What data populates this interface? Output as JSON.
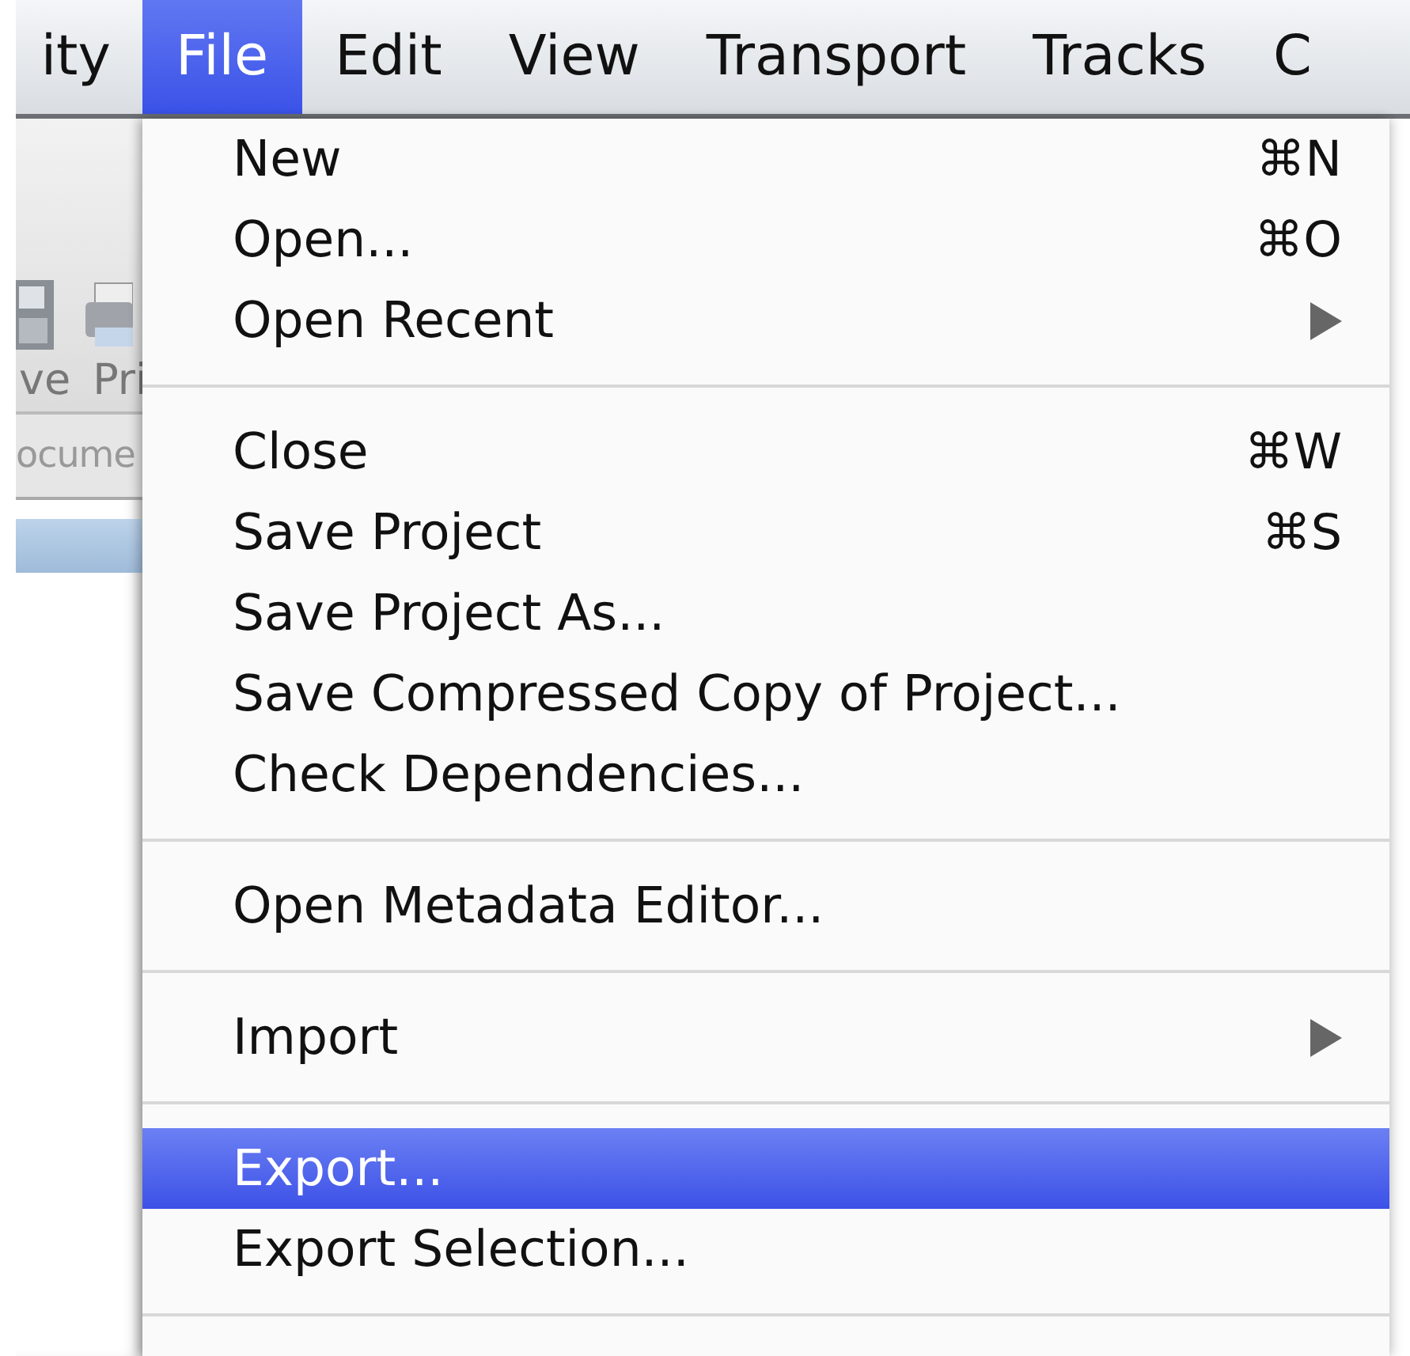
{
  "menubar": {
    "items": [
      {
        "label": "ity",
        "selected": false
      },
      {
        "label": "File",
        "selected": true
      },
      {
        "label": "Edit",
        "selected": false
      },
      {
        "label": "View",
        "selected": false
      },
      {
        "label": "Transport",
        "selected": false
      },
      {
        "label": "Tracks",
        "selected": false
      },
      {
        "label": "C",
        "selected": false
      }
    ]
  },
  "background_window": {
    "toolbar_labels": [
      "ve",
      "Pri"
    ],
    "tab_label": "ocume"
  },
  "menu": {
    "items": [
      {
        "kind": "item",
        "label": "New",
        "shortcut": "⌘N",
        "submenu": false,
        "selected": false
      },
      {
        "kind": "item",
        "label": "Open...",
        "shortcut": "⌘O",
        "submenu": false,
        "selected": false
      },
      {
        "kind": "item",
        "label": "Open Recent",
        "submenu": true,
        "selected": false
      },
      {
        "kind": "separator"
      },
      {
        "kind": "item",
        "label": "Close",
        "shortcut": "⌘W",
        "submenu": false,
        "selected": false
      },
      {
        "kind": "item",
        "label": "Save Project",
        "shortcut": "⌘S",
        "submenu": false,
        "selected": false
      },
      {
        "kind": "item",
        "label": "Save Project As...",
        "submenu": false,
        "selected": false
      },
      {
        "kind": "item",
        "label": "Save Compressed Copy of Project...",
        "submenu": false,
        "selected": false
      },
      {
        "kind": "item",
        "label": "Check Dependencies...",
        "submenu": false,
        "selected": false
      },
      {
        "kind": "separator"
      },
      {
        "kind": "item",
        "label": "Open Metadata Editor...",
        "submenu": false,
        "selected": false
      },
      {
        "kind": "separator"
      },
      {
        "kind": "item",
        "label": "Import",
        "submenu": true,
        "selected": false
      },
      {
        "kind": "separator"
      },
      {
        "kind": "item",
        "label": "Export...",
        "submenu": false,
        "selected": true
      },
      {
        "kind": "item",
        "label": "Export Selection...",
        "submenu": false,
        "selected": false
      },
      {
        "kind": "separator"
      }
    ]
  }
}
